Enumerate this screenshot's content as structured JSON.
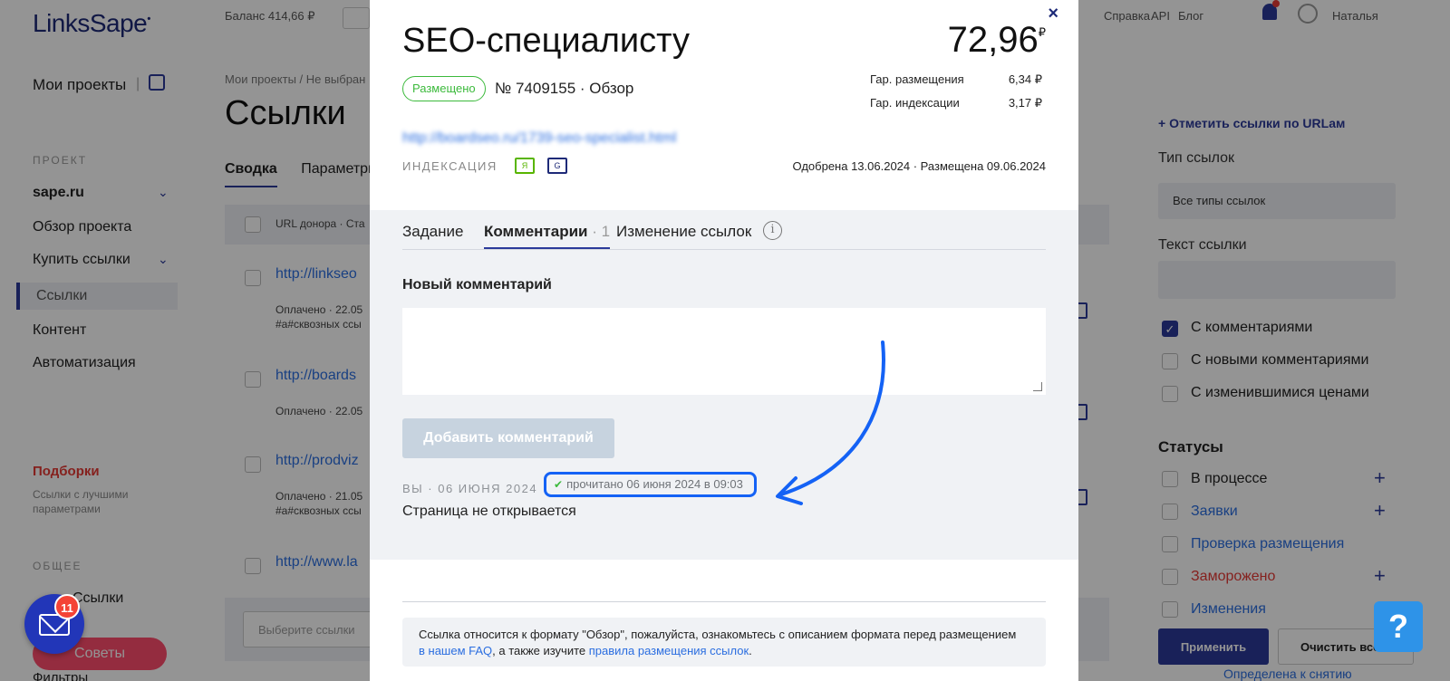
{
  "app": {
    "logo": "LinksSape",
    "topbar": {
      "balance": "Баланс 414,66 ₽",
      "links": [
        "Справка",
        "API",
        "Блог"
      ],
      "user": "Наталья"
    },
    "sidebar": {
      "my_projects": "Мои проекты",
      "section_project": "ПРОЕКТ",
      "project_name": "sape.ru",
      "items": [
        "Обзор проекта",
        "Купить ссылки",
        "Ссылки",
        "Контент",
        "Автоматизация"
      ],
      "podborki": "Подборки",
      "podborki_note": "Ссылки с лучшими параметрами",
      "section_general": "ОБЩЕЕ",
      "general_item": "Ссылки",
      "advice": "Советы",
      "filters": "Фильтры"
    },
    "main": {
      "breadcrumb": "Мои проекты / Не выбран",
      "title": "Ссылки",
      "tabs": [
        "Сводка",
        "Параметры"
      ],
      "table_header": "URL донора · Ста",
      "rows": [
        {
          "url": "http://linkseo",
          "meta": "Оплачено · 22.05",
          "meta2": "#a#сквозных ссы"
        },
        {
          "url": "http://boards",
          "meta": "Оплачено · 22.05",
          "meta2": ""
        },
        {
          "url": "http://prodviz",
          "meta": "Оплачено · 21.05",
          "meta2": "#a#сквозных ссы"
        },
        {
          "url": "http://www.la",
          "meta": "",
          "meta2": ""
        }
      ],
      "select_placeholder": "Выберите ссылки"
    },
    "right_panel": {
      "mark_by_url": "Отметить ссылки по URLам",
      "link_type_label": "Тип ссылок",
      "link_type_value": "Все типы ссылок",
      "link_text_label": "Текст ссылки",
      "filters": [
        "С комментариями",
        "С новыми комментариями",
        "С изменившимися ценами"
      ],
      "statuses_heading": "Статусы",
      "statuses": [
        {
          "label": "В процессе",
          "color": "#222222",
          "plus": true
        },
        {
          "label": "Заявки",
          "color": "#2b6ee0",
          "plus": true
        },
        {
          "label": "Проверка размещения",
          "color": "#2b6ee0",
          "plus": false
        },
        {
          "label": "Заморожено",
          "color": "#e53935",
          "plus": true
        },
        {
          "label": "Изменения",
          "color": "#2b6ee0",
          "plus": false
        }
      ],
      "apply": "Применить",
      "clear": "Очистить все",
      "bottom_text": "Определена к снятию"
    },
    "mail_badge": "11",
    "help": "?"
  },
  "modal": {
    "close": "×",
    "title": "SEO-специалисту",
    "price": "72,96",
    "currency": "₽",
    "badge": "Размещено",
    "number": "№ 7409155 · Обзор",
    "guarantee": [
      {
        "label": "Гар. размещения",
        "value": "6,34 ₽"
      },
      {
        "label": "Гар. индексации",
        "value": "3,17 ₽"
      }
    ],
    "link": "http://boardseo.ru/1739-seo-specialist.html",
    "indexation_label": "ИНДЕКСАЦИЯ",
    "ya_icon_text": "Я",
    "g_icon_text": "G",
    "dates": "Одобрена 13.06.2024 · Размещена 09.06.2024",
    "tabs": [
      {
        "label": "Задание"
      },
      {
        "label": "Комментарии",
        "count": "· 1"
      },
      {
        "label": "Изменение ссылок"
      }
    ],
    "new_comment_label": "Новый комментарий",
    "add_comment": "Добавить комментарий",
    "comment": {
      "author_date": "ВЫ · 06 ИЮНЯ 2024",
      "read_status": "прочитано 06 июня 2024 в 09:03",
      "text": "Страница не открывается"
    },
    "notice": {
      "text1": "Ссылка относится к формату \"Обзор\", пожалуйста, ознакомьтесь с описанием формата перед размещением",
      "link1": "в нашем FAQ",
      "text2": ", а также изучите ",
      "link2": "правила размещения ссылок",
      "text3": "."
    }
  },
  "colors": {
    "accent": "#2b3a9a",
    "highlight": "#1462f5",
    "placed_green": "#3cba3c",
    "link_blue": "#2b6ee0"
  }
}
